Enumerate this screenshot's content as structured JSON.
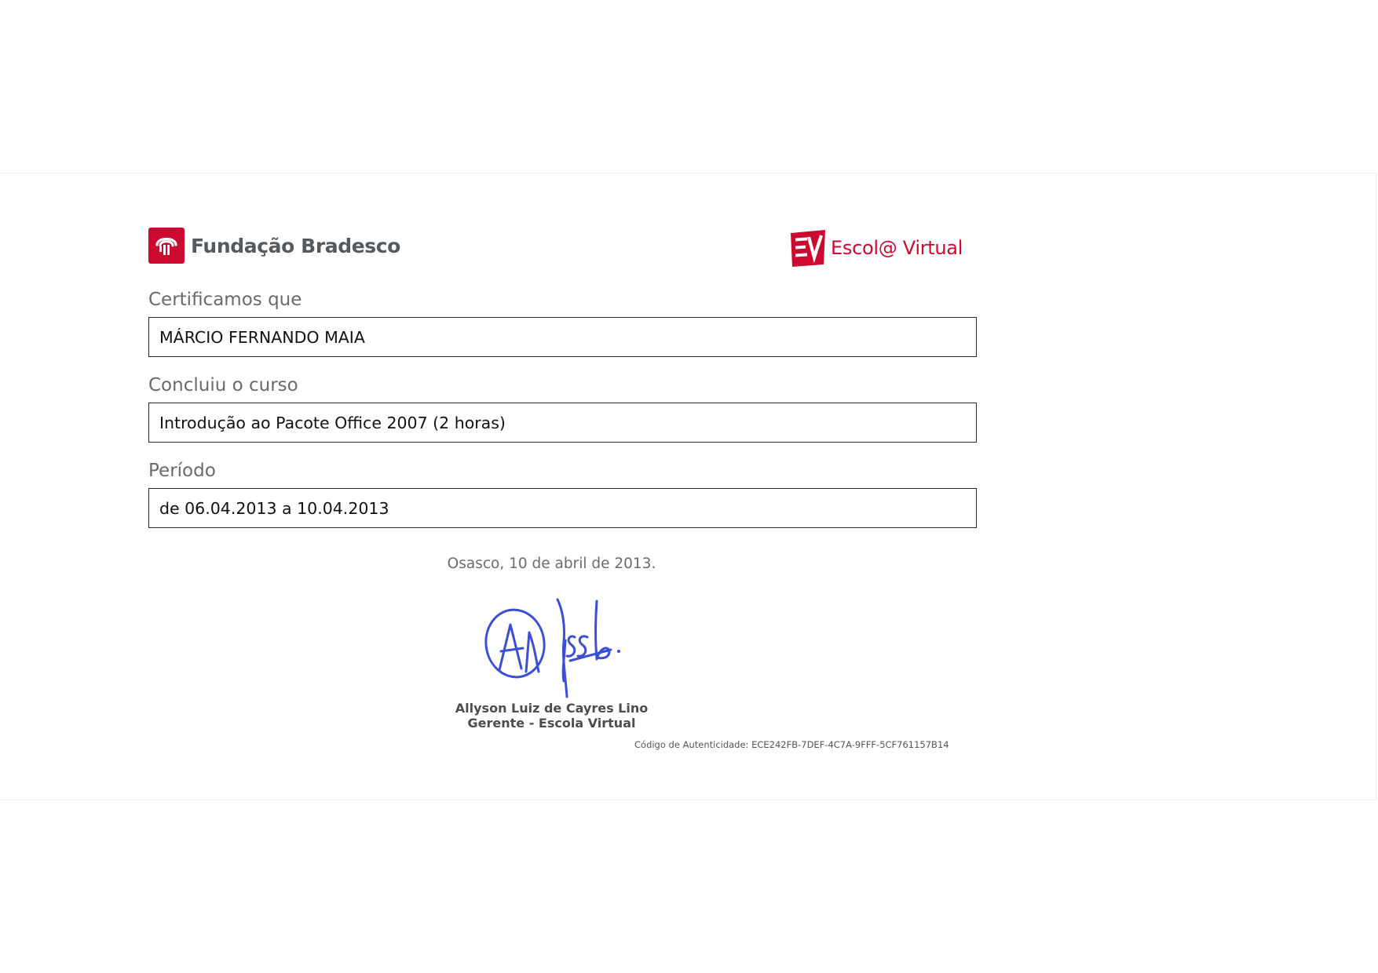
{
  "header": {
    "left_brand": "Fundação Bradesco",
    "right_brand": "Escol@ Virtual",
    "right_logo_text": "EV"
  },
  "fields": [
    {
      "label": "Certificamos que",
      "value": "MÁRCIO FERNANDO MAIA"
    },
    {
      "label": "Concluiu o curso",
      "value": "Introdução ao Pacote Office 2007 (2 horas)"
    },
    {
      "label": "Período",
      "value": "de 06.04.2013 a 10.04.2013"
    }
  ],
  "place_date": "Osasco, 10 de abril de 2013.",
  "signer": {
    "name": "Allyson Luiz de Cayres Lino",
    "role": "Gerente - Escola Virtual"
  },
  "authenticity": "Código de Autenticidade: ECE242FB-7DEF-4C7A-9FFF-5CF761157B14",
  "colors": {
    "brand_red": "#cc092f",
    "signature_blue": "#3a4fd6"
  }
}
